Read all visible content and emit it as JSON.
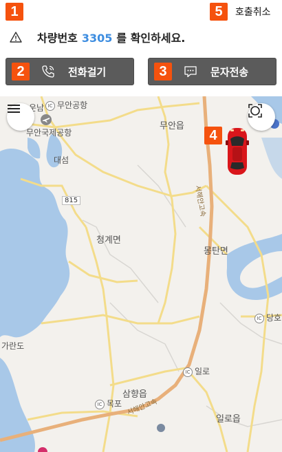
{
  "header": {
    "badge1": "1",
    "badge5": "5",
    "cancel_label": "호출취소"
  },
  "notice": {
    "prefix": "차량번호",
    "plate": "3305",
    "suffix": "를 확인하세요."
  },
  "actions": {
    "call": {
      "badge": "2",
      "label": "전화걸기"
    },
    "sms": {
      "badge": "3",
      "label": "문자전송"
    }
  },
  "map": {
    "car_badge": "4",
    "labels": {
      "unnam": "운남",
      "muan_airport_ic": "무안공항",
      "muan_intl_airport": "무안국제공항",
      "daeseom": "대섬",
      "route_815": "815",
      "muaneup": "무안읍",
      "cheonggyemyeon": "청계면",
      "mongtanmyeon": "몽탄면",
      "garando": "가란도",
      "dangho": "당호",
      "illo_ic": "일로",
      "samhyangeup": "삼향읍",
      "mokpo_ic": "목포",
      "iloeup": "일로읍",
      "seohaean_1": "서해안고속",
      "seohaean_2": "서해안고속",
      "ic": "IC"
    },
    "colors": {
      "water": "#a8c8e8",
      "land": "#f3f1ed",
      "road_yellow": "#f3dc8a",
      "highway": "#e8b07a",
      "car": "#d9161b",
      "badge": "#f5520e"
    }
  }
}
